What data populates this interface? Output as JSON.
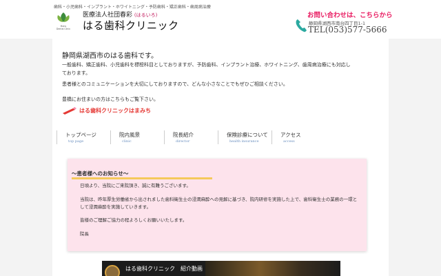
{
  "header": {
    "services_line": "歯科・小児歯科・インプラント・ホワイトニング・予防歯科・矯正歯科・歯周病治療",
    "logo_text": "Haru Dental Clinic",
    "corp_name": "医療法人社団春彩",
    "corp_kana": "(はるいろ)",
    "clinic_name": "はる歯科クリニック",
    "contact_label": "お問い合わせは、こちらから",
    "address": "静岡県湖西市南台四丁目1-1",
    "tel": "TEL(053)577-5666"
  },
  "intro": {
    "title": "静岡県湖西市のはる歯科です。",
    "paragraph1": "一般歯科、矯正歯科、小児歯科を標榜科目としておりますが、予防歯科、インプラント治療、ホワイトニング、歯周病治療にも対応しております。",
    "paragraph2": "患者様とのコミュニケーションを大切にしておりますので、どんな小さなことでもぜひご相談ください。",
    "toyohashi_text": "豊橋にお住まいの方はこちらもご覧下さい。",
    "hamamichi_link": "はる歯科クリニックはまみち"
  },
  "nav": {
    "items": [
      {
        "jp": "トップページ",
        "en": "top page"
      },
      {
        "jp": "院内風景",
        "en": "clinic"
      },
      {
        "jp": "院長紹介",
        "en": "director"
      },
      {
        "jp": "保険診療について",
        "en": "health insurance"
      },
      {
        "jp": "アクセス",
        "en": "access"
      }
    ]
  },
  "notice": {
    "title": "～患者様へのお知らせ～",
    "p1": "日頃より、当院にご来院頂き、誠に有難うございます。",
    "p2": "当院は、昨年厚生労働省から出されました歯科衛生士の浸潤麻酔への見解に基づき、院内研修を実施した上で、歯科衛生士の業務の一環として浸潤麻酔を実施していきます。",
    "p3": "皆様のご理解ご協力の程よろしくお願いいたします。",
    "p4": "院長"
  },
  "video": {
    "title": "はる歯科クリニック　紹介動画"
  },
  "colors": {
    "accent_pink": "#e91e63",
    "notice_bg": "#fde3ec",
    "underline": "#f5c95a",
    "link_red": "#e53935"
  }
}
